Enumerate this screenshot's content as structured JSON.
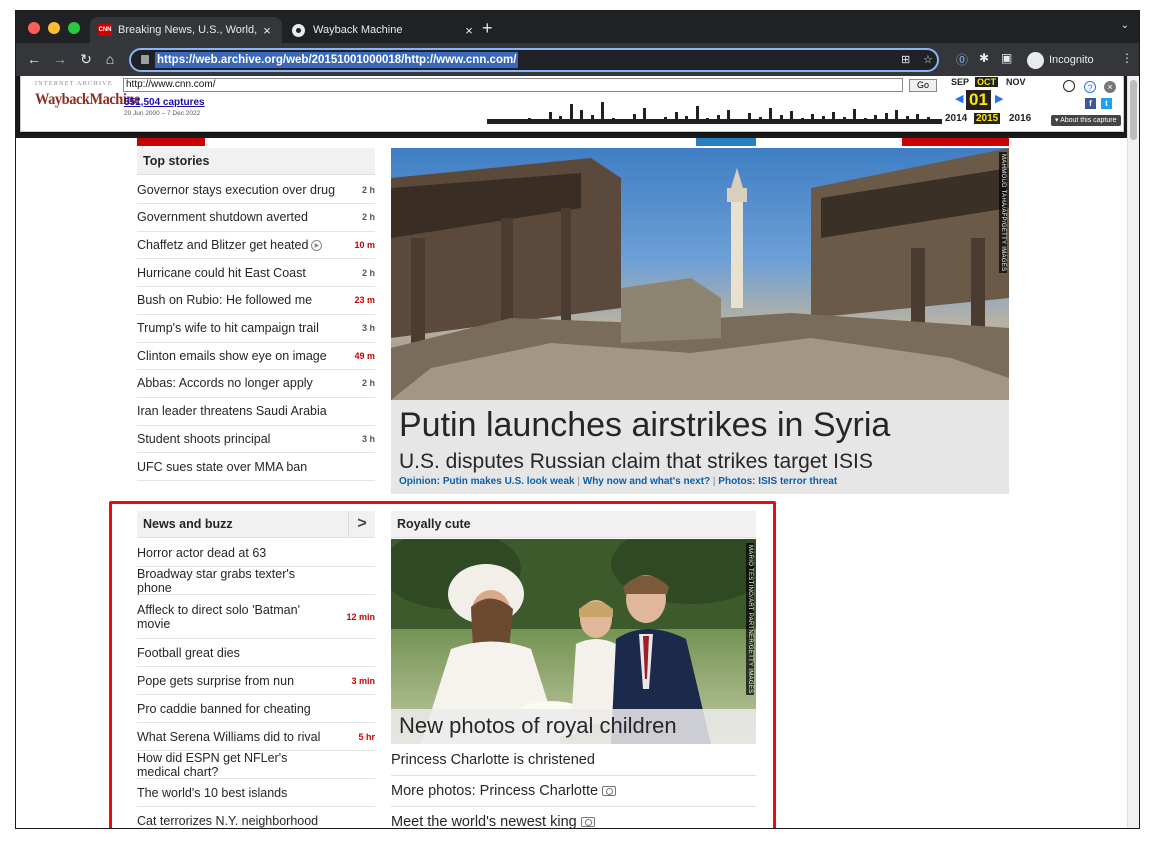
{
  "browser": {
    "tabs": [
      {
        "title": "Breaking News, U.S., World, W",
        "favicon": "CNN",
        "close": "×"
      },
      {
        "title": "Wayback Machine",
        "close": "×"
      }
    ],
    "new_tab": "+",
    "tab_menu": "⌄",
    "url": "https://web.archive.org/web/20151001000018/http://www.cnn.com/",
    "incognito_label": "Incognito"
  },
  "wayback": {
    "ia_label": "INTERNET ARCHIVE",
    "logo": "WaybackMachine",
    "url_value": "http://www.cnn.com/",
    "go_label": "Go",
    "captures": "551,504 captures",
    "date_range": "20 Jun 2000 – 7 Dec 2022",
    "months": {
      "prev": "SEP",
      "current": "OCT",
      "next": "NOV"
    },
    "day": "01",
    "years": {
      "prev": "2014",
      "current": "2015",
      "next": "2016"
    },
    "about": "▾ About this capture",
    "colors": {
      "logo": "#8b2f23",
      "highlight": "#ffe900",
      "arrows": "#2672ec"
    }
  },
  "top_stories": {
    "heading": "Top stories",
    "items": [
      {
        "text": "Governor stays execution over drug",
        "time": "2 h",
        "red": false
      },
      {
        "text": "Government shutdown averted",
        "time": "2 h",
        "red": false
      },
      {
        "text": "Chaffetz and Blitzer get heated",
        "time": "10 m",
        "red": true,
        "video": true
      },
      {
        "text": "Hurricane could hit East Coast",
        "time": "2 h",
        "red": false
      },
      {
        "text": "Bush on Rubio: He followed me",
        "time": "23 m",
        "red": true
      },
      {
        "text": "Trump's wife to hit campaign trail",
        "time": "3 h",
        "red": false
      },
      {
        "text": "Clinton emails show eye on image",
        "time": "49 m",
        "red": true
      },
      {
        "text": "Abbas: Accords no longer apply",
        "time": "2 h",
        "red": false
      },
      {
        "text": "Iran leader threatens Saudi Arabia",
        "time": "",
        "red": false
      },
      {
        "text": "Student shoots principal",
        "time": "3 h",
        "red": false
      },
      {
        "text": "UFC sues state over MMA ban",
        "time": "",
        "red": false
      }
    ]
  },
  "hero": {
    "title": "Putin launches airstrikes in Syria",
    "subtitle": "U.S. disputes Russian claim that strikes target ISIS",
    "links": [
      "Opinion: Putin makes U.S. look weak",
      "Why now and what's next?",
      "Photos: ISIS terror threat"
    ],
    "credit": "MAHMOUD TAHA/AFP/GETTY IMAGES"
  },
  "news_buzz": {
    "heading": "News and buzz",
    "chevron": ">",
    "items": [
      {
        "text": "Horror actor dead at 63",
        "time": ""
      },
      {
        "text": "Broadway star grabs texter's phone",
        "time": ""
      },
      {
        "text": "Affleck to direct solo 'Batman' movie",
        "time": "12 min"
      },
      {
        "text": "Football great dies",
        "time": ""
      },
      {
        "text": "Pope gets surprise from nun",
        "time": "3 min"
      },
      {
        "text": "Pro caddie banned for cheating",
        "time": ""
      },
      {
        "text": "What Serena Williams did to rival",
        "time": "5 hr"
      },
      {
        "text": "How did ESPN get NFLer's medical chart?",
        "time": ""
      },
      {
        "text": "The world's 10 best islands",
        "time": ""
      },
      {
        "text": "Cat terrorizes N.Y. neighborhood",
        "time": ""
      }
    ]
  },
  "royal": {
    "heading": "Royally cute",
    "title": "New photos of royal children",
    "credit": "MARIO TESTINO/ART PARTNER/GETTY IMAGES",
    "links": [
      {
        "text": "Princess Charlotte is christened",
        "camera": false
      },
      {
        "text": "More photos: Princess Charlotte",
        "camera": true
      },
      {
        "text": "Meet the world's newest king",
        "camera": true
      }
    ]
  }
}
